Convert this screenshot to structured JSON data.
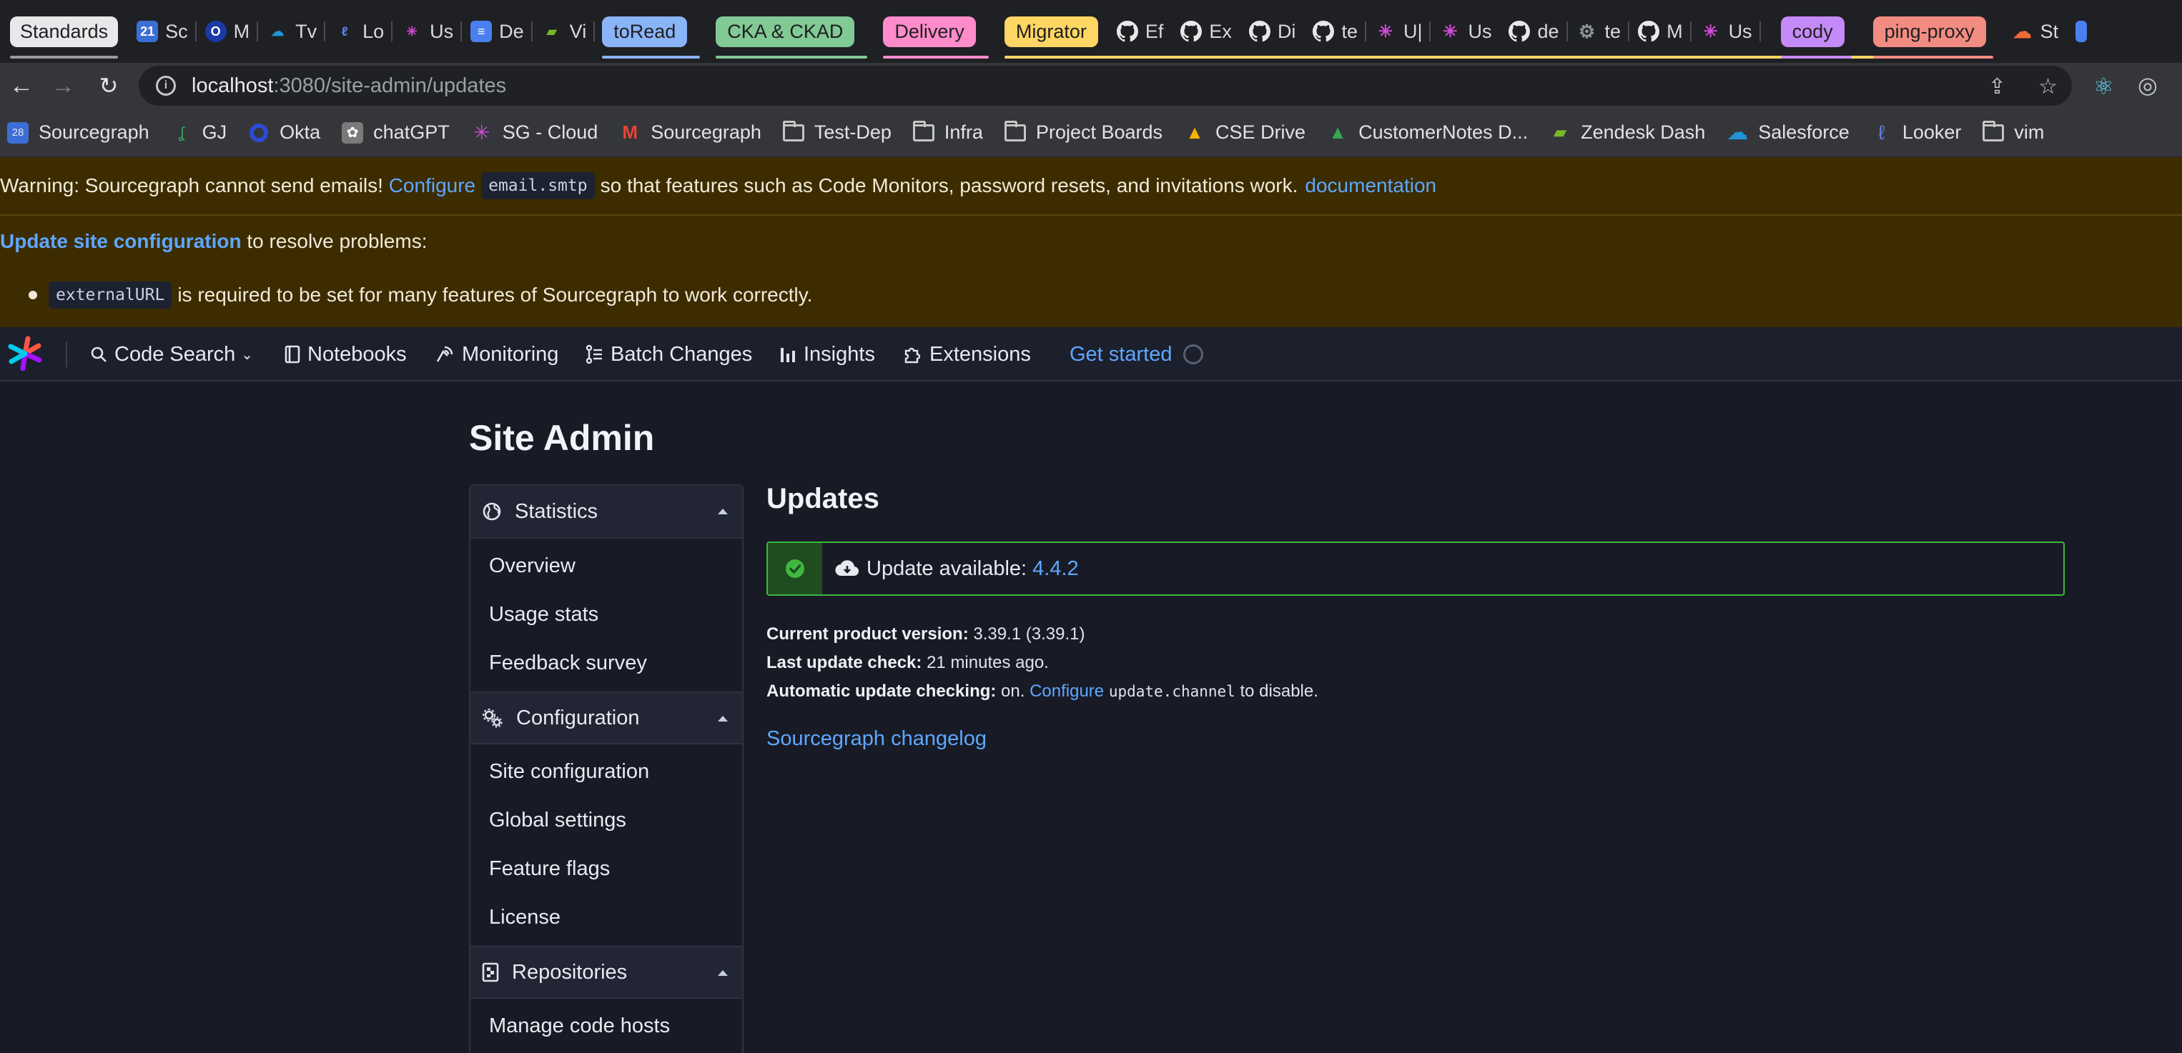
{
  "browser": {
    "tabs": [
      {
        "label": "Standards",
        "type": "active"
      },
      {
        "label": "Sc",
        "icon_text": "21",
        "icon_color": "#3b6fd6"
      },
      {
        "label": "M",
        "icon_text": "O",
        "icon_color": "#1a3aa6"
      },
      {
        "label": "Tv",
        "icon_text": "☁",
        "icon_color": "#1f94d8"
      },
      {
        "label": "Lo",
        "icon_text": "ℓ",
        "icon_color": "#3e63d8"
      },
      {
        "label": "Us",
        "icon_text": "✳",
        "icon_color": "#a33ecb"
      },
      {
        "label": "De",
        "icon_text": "≡",
        "icon_color": "#4a7ff0"
      },
      {
        "label": "Vi",
        "icon_text": "▰",
        "icon_color": "#78b62a"
      }
    ],
    "groups": [
      {
        "label": "toRead",
        "color": "#8ab4f8"
      },
      {
        "label": "CKA & CKAD",
        "color": "#81c995"
      },
      {
        "label": "Delivery",
        "color": "#ff8bcb"
      },
      {
        "label": "Migrator",
        "color": "#fdd663"
      }
    ],
    "tabs2": [
      {
        "label": "Ef",
        "icon": "github"
      },
      {
        "label": "Ex",
        "icon": "github"
      },
      {
        "label": "Di",
        "icon": "github"
      },
      {
        "label": "te",
        "icon": "github"
      },
      {
        "label": "U|",
        "icon": "sg"
      },
      {
        "label": "Us",
        "icon": "sg"
      },
      {
        "label": "de",
        "icon": "github"
      },
      {
        "label": "te",
        "icon": "gear"
      },
      {
        "label": "M",
        "icon": "github"
      },
      {
        "label": "Us",
        "icon": "sg"
      }
    ],
    "groups2": [
      {
        "label": "cody",
        "color": "#c58af9"
      },
      {
        "label": "ping-proxy",
        "color": "#f28b82"
      }
    ],
    "tabs3": [
      {
        "label": "St",
        "icon": "cloud"
      }
    ],
    "url_host": "localhost",
    "url_path": ":3080/site-admin/updates"
  },
  "bookmarks": [
    {
      "label": "Sourcegraph",
      "icon": "calendar-icon",
      "color": "#3b6fd6"
    },
    {
      "label": "GJ",
      "icon": "link-icon",
      "color": "#3a9a5a"
    },
    {
      "label": "Okta",
      "icon": "okta-icon",
      "color": "#1a3aa6"
    },
    {
      "label": "chatGPT",
      "icon": "chatgpt-icon",
      "color": "#7a7a7a"
    },
    {
      "label": "SG - Cloud",
      "icon": "sg-icon",
      "color": "#a33ecb"
    },
    {
      "label": "Sourcegraph",
      "icon": "gmail-icon",
      "color": "#d93025"
    },
    {
      "label": "Test-Dep",
      "icon": "folder-icon"
    },
    {
      "label": "Infra",
      "icon": "folder-icon"
    },
    {
      "label": "Project Boards",
      "icon": "folder-icon"
    },
    {
      "label": "CSE Drive",
      "icon": "drive-icon",
      "color": "#f4b400"
    },
    {
      "label": "CustomerNotes D...",
      "icon": "drive-icon",
      "color": "#34a853"
    },
    {
      "label": "Zendesk Dash",
      "icon": "zendesk-icon",
      "color": "#78b62a"
    },
    {
      "label": "Salesforce",
      "icon": "salesforce-icon",
      "color": "#1f94d8"
    },
    {
      "label": "Looker",
      "icon": "looker-icon",
      "color": "#3e63d8"
    },
    {
      "label": "vim",
      "icon": "folder-icon"
    }
  ],
  "warning": {
    "prefix": "Warning: Sourcegraph cannot send emails! ",
    "configure": "Configure",
    "code": "email.smtp",
    "middle": "so that features such as Code Monitors, password resets, and invitations work.",
    "doc": "documentation"
  },
  "problems": {
    "link": "Update site configuration",
    "suffix": " to resolve problems:",
    "item_code": "externalURL",
    "item_text": "is required to be set for many features of Sourcegraph to work correctly."
  },
  "nav": {
    "code_search": "Code Search",
    "notebooks": "Notebooks",
    "monitoring": "Monitoring",
    "batch_changes": "Batch Changes",
    "insights": "Insights",
    "extensions": "Extensions",
    "get_started": "Get started"
  },
  "page_title": "Site Admin",
  "sidebar": {
    "statistics": "Statistics",
    "overview": "Overview",
    "usage_stats": "Usage stats",
    "feedback_survey": "Feedback survey",
    "configuration": "Configuration",
    "site_configuration": "Site configuration",
    "global_settings": "Global settings",
    "feature_flags": "Feature flags",
    "license": "License",
    "repositories": "Repositories",
    "manage_code_hosts": "Manage code hosts"
  },
  "updates": {
    "heading": "Updates",
    "alert_prefix": "Update available: ",
    "alert_version": "4.4.2",
    "current_label": "Current product version:",
    "current_value": " 3.39.1 (3.39.1)",
    "last_label": "Last update check:",
    "last_value": " 21 minutes ago.",
    "auto_label": "Automatic update checking:",
    "auto_value": " on. ",
    "auto_link": "Configure",
    "auto_code": "update.channel",
    "auto_suffix": " to disable.",
    "changelog": "Sourcegraph changelog"
  },
  "colors": {
    "accent": "#5ea7ff",
    "warning_bg": "#3c2c00",
    "success": "#3eb73e"
  }
}
